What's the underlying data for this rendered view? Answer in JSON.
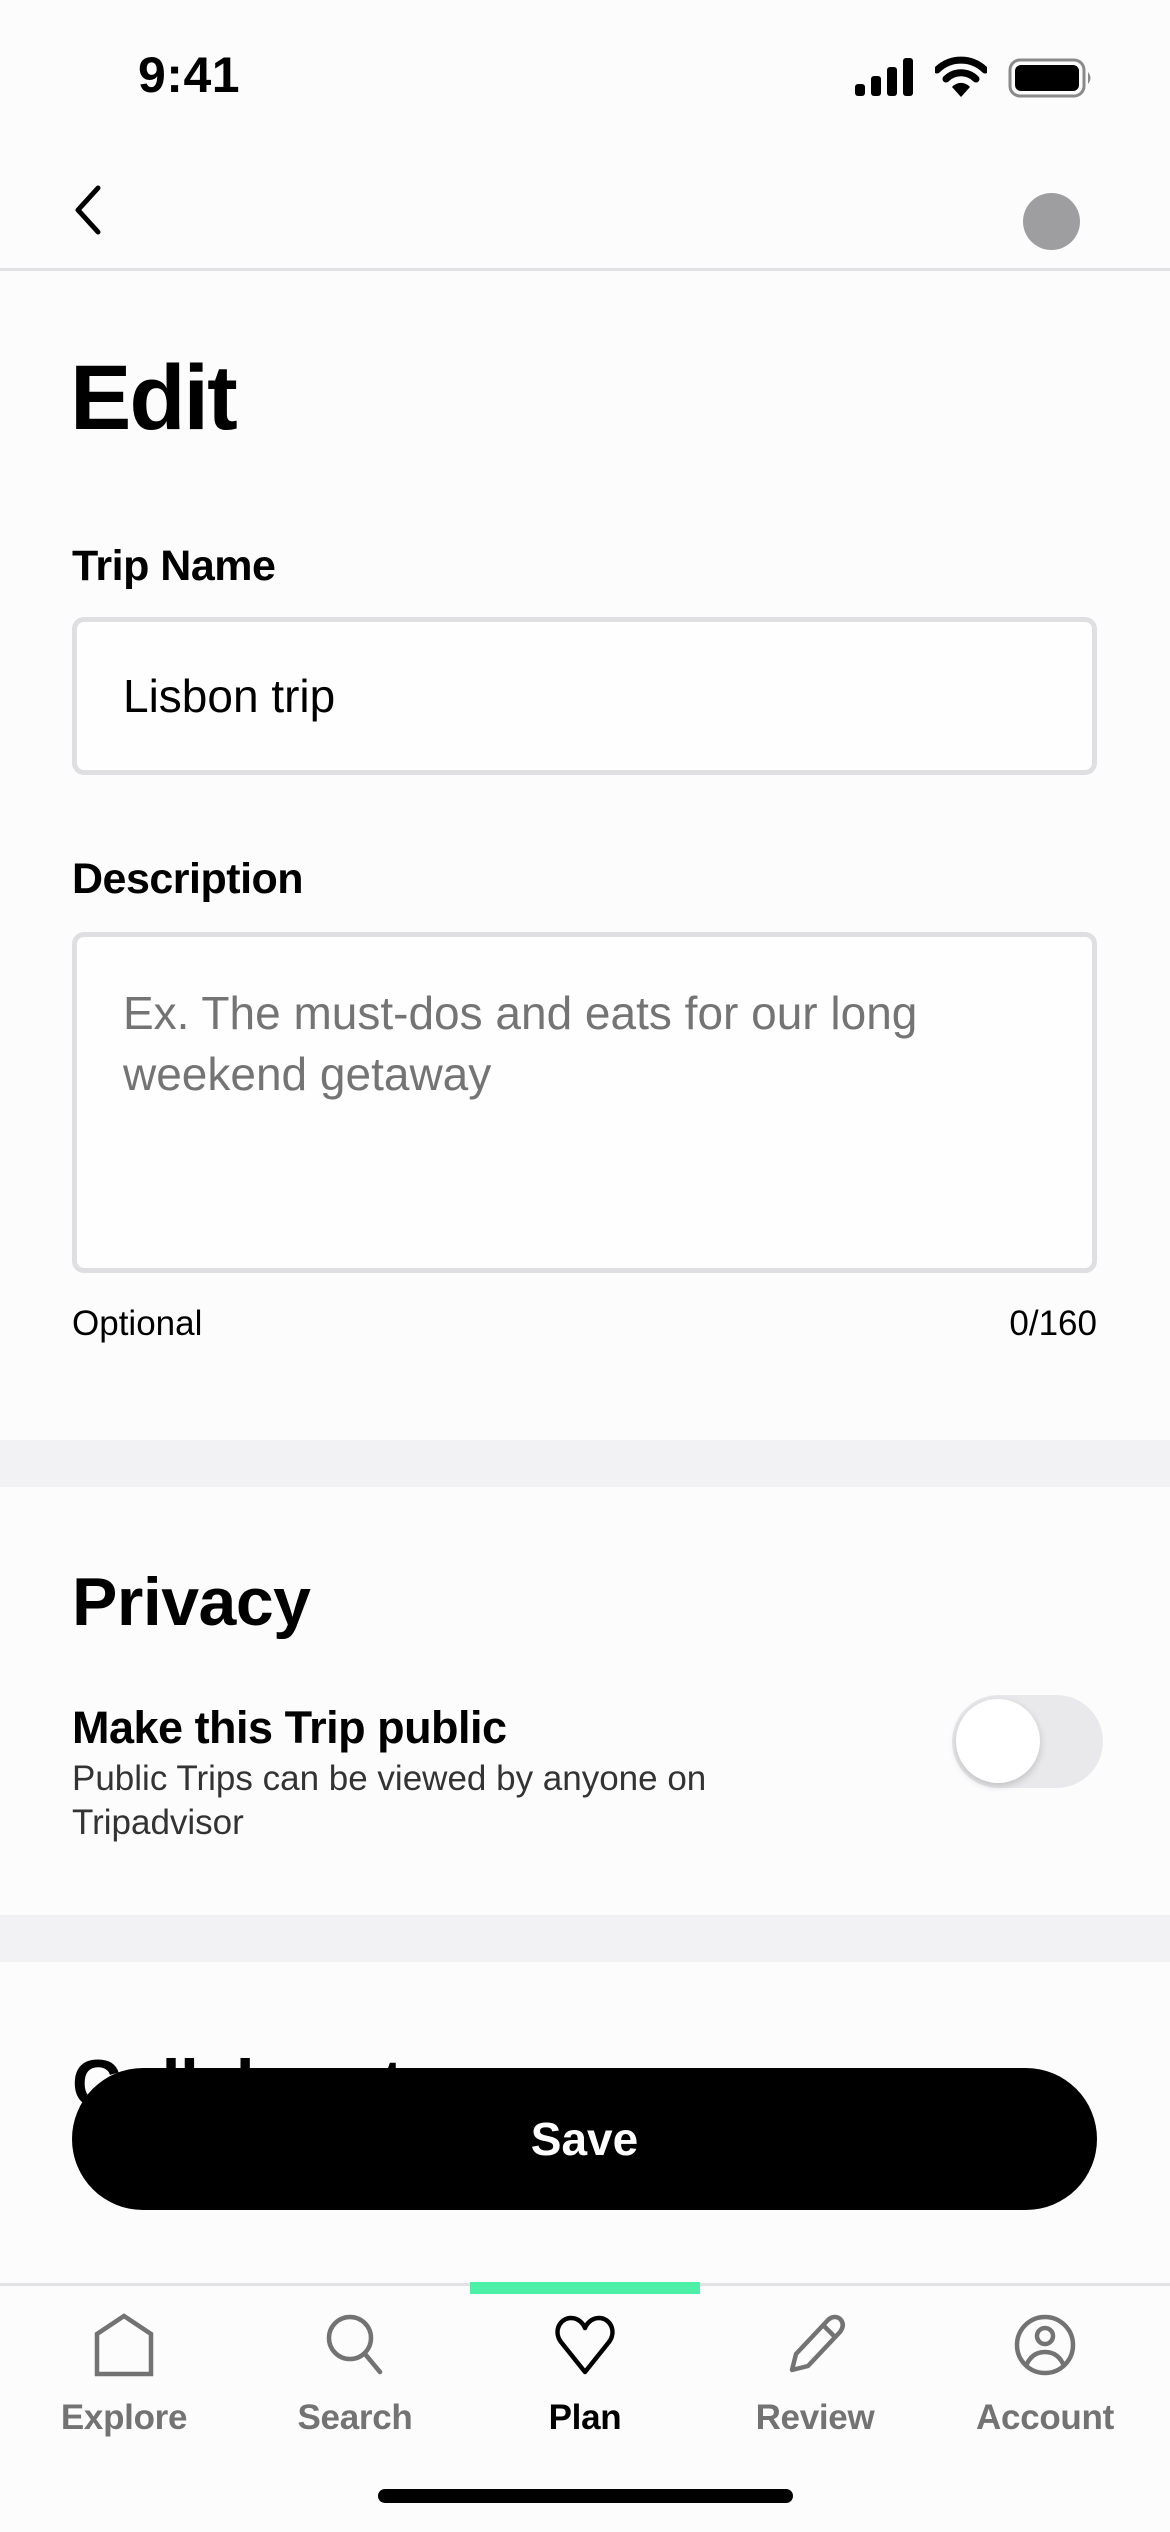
{
  "status_bar": {
    "time": "9:41",
    "icons": [
      "cellular-signal-icon",
      "wifi-icon",
      "battery-icon"
    ]
  },
  "header": {
    "back_icon": "chevron-left-icon",
    "avatar_icon": "avatar-placeholder"
  },
  "page": {
    "title": "Edit"
  },
  "form": {
    "trip_name": {
      "label": "Trip Name",
      "value": "Lisbon trip"
    },
    "description": {
      "label": "Description",
      "value": "",
      "placeholder": "Ex. The must-dos and eats for our long weekend getaway",
      "helper": "Optional",
      "counter": "0/160"
    }
  },
  "privacy": {
    "title": "Privacy",
    "public_toggle": {
      "label": "Make this Trip public",
      "description": "Public Trips can be viewed by anyone on Tripadvisor",
      "enabled": false
    }
  },
  "collaborators": {
    "title": "Collaborators"
  },
  "actions": {
    "save_label": "Save"
  },
  "colors": {
    "accent": "#4cf0a6",
    "button": "#000000",
    "avatar": "#9e9d9f",
    "muted_text": "#737373"
  },
  "tab_bar": {
    "active_index": 2,
    "tabs": [
      {
        "label": "Explore",
        "icon": "home-icon"
      },
      {
        "label": "Search",
        "icon": "search-icon"
      },
      {
        "label": "Plan",
        "icon": "heart-icon"
      },
      {
        "label": "Review",
        "icon": "pencil-icon"
      },
      {
        "label": "Account",
        "icon": "user-circle-icon"
      }
    ]
  }
}
